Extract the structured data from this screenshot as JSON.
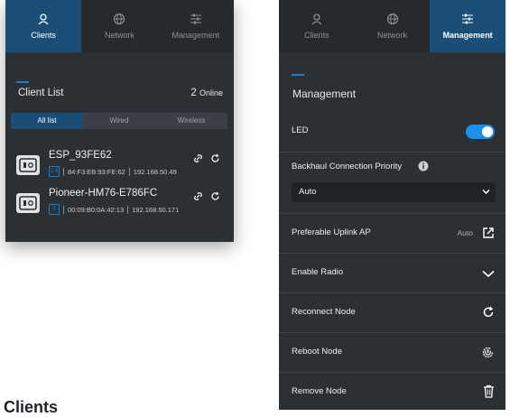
{
  "left_panel": {
    "tabs": [
      {
        "label": "Clients",
        "icon": "clients-icon",
        "active": true
      },
      {
        "label": "Network",
        "icon": "globe-icon",
        "active": false
      },
      {
        "label": "Management",
        "icon": "sliders-icon",
        "active": false
      }
    ],
    "section_title": "Client List",
    "online_count": "2",
    "online_label": "Online",
    "filters": [
      {
        "label": "All list",
        "active": true
      },
      {
        "label": "Wired",
        "active": false
      },
      {
        "label": "Wireless",
        "active": false
      }
    ],
    "clients": [
      {
        "name": "ESP_93FE62",
        "mac": "84:F3:EB:93:FE:62",
        "ip": "192.168.50.49",
        "band": "2.4"
      },
      {
        "name": "Pioneer-HM76-E786FC",
        "mac": "00:09:B0:0A:42:13",
        "ip": "192.168.50.171",
        "band": "5"
      }
    ]
  },
  "right_panel": {
    "tabs": [
      {
        "label": "Clients",
        "icon": "clients-icon",
        "active": false
      },
      {
        "label": "Network",
        "icon": "globe-icon",
        "active": false
      },
      {
        "label": "Management",
        "icon": "sliders-icon",
        "active": true
      }
    ],
    "section_title": "Management",
    "led_label": "LED",
    "led_on": true,
    "backhaul_label": "Backhaul Connection Priority",
    "backhaul_value": "Auto",
    "uplink_label": "Preferable Uplink AP",
    "uplink_value": "Auto",
    "enable_radio_label": "Enable Radio",
    "reconnect_label": "Reconnect Node",
    "reboot_label": "Reboot Node",
    "remove_label": "Remove Node"
  },
  "caption": "Clients",
  "colors": {
    "accent": "#1b4e76",
    "toggle": "#1b90e8",
    "panel": "#2b3034"
  }
}
